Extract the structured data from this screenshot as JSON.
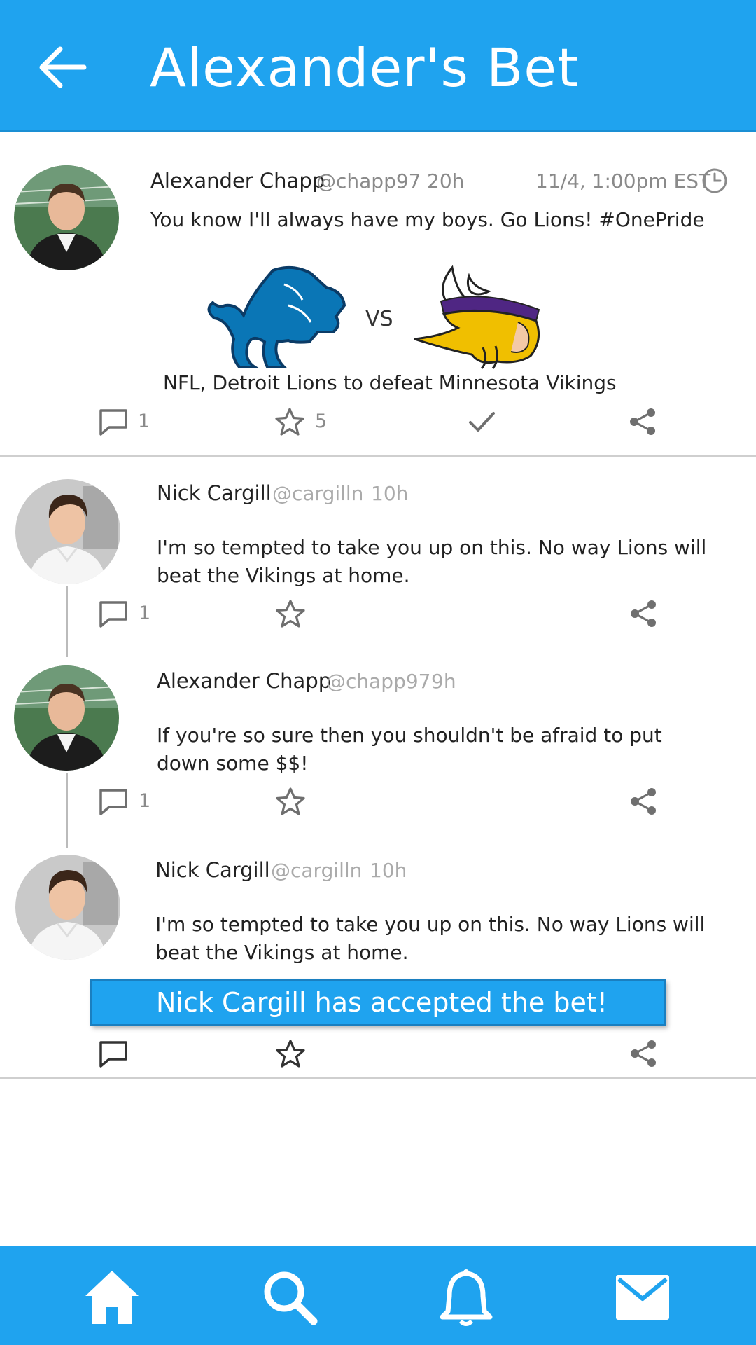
{
  "header": {
    "title": "Alexander's Bet",
    "color": "#1fa3ef"
  },
  "main_post": {
    "author_name": "Alexander Chapp",
    "handle": "@chapp97",
    "age": "20h",
    "event_time": "11/4, 1:00pm EST",
    "text": "You know I'll always have my boys. Go Lions! #OnePride",
    "matchup": {
      "team_a_logo": "detroit-lions-logo",
      "vs_label": "VS",
      "team_b_logo": "minnesota-vikings-logo",
      "bet_description": "NFL, Detroit Lions to defeat Minnesota Vikings"
    },
    "comment_count": "1",
    "star_count": "5"
  },
  "replies": [
    {
      "author_name": "Nick Cargill",
      "handle": "@cargilln",
      "age": "10h",
      "text": "I'm so tempted to take you up on this. No way Lions will beat the Vikings at home.",
      "comment_count": "1"
    },
    {
      "author_name": "Alexander Chapp",
      "handle": "@chapp97",
      "age": "9h",
      "text": "If you're so sure then you shouldn't be afraid to put down some $$!",
      "comment_count": "1"
    },
    {
      "author_name": "Nick Cargill",
      "handle": "@cargilln",
      "age": "10h",
      "text": "I'm so tempted to take you up on this. No way Lions will beat the Vikings at home.",
      "accepted_banner": "Nick Cargill has accepted the bet!"
    }
  ],
  "bottom_nav": {
    "items": [
      "home-icon",
      "search-icon",
      "bell-icon",
      "mail-icon"
    ]
  },
  "colors": {
    "accent": "#1fa3ef",
    "lions_blue": "#0a76b6",
    "vikings_purple": "#4f2683",
    "vikings_gold": "#f0bf00"
  }
}
